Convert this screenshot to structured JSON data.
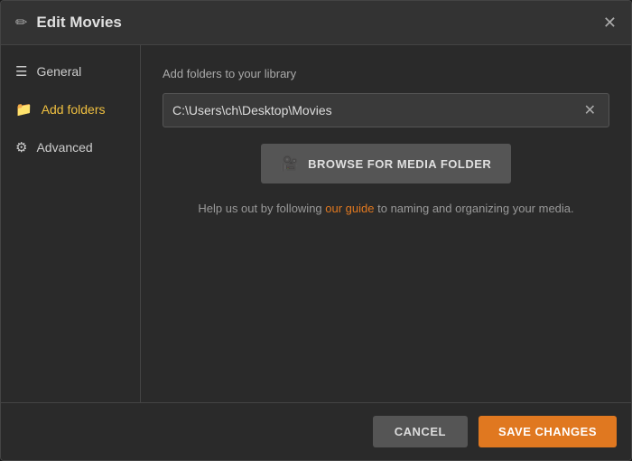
{
  "dialog": {
    "title": "Edit Movies",
    "close_icon": "✕"
  },
  "sidebar": {
    "items": [
      {
        "id": "general",
        "label": "General",
        "icon": "☰",
        "active": false
      },
      {
        "id": "add-folders",
        "label": "Add folders",
        "icon": "📁",
        "active": true
      },
      {
        "id": "advanced",
        "label": "Advanced",
        "icon": "⚙",
        "active": false
      }
    ]
  },
  "main": {
    "section_title": "Add folders to your library",
    "folder_path": "C:\\Users\\ch\\Desktop\\Movies",
    "browse_button_label": "BROWSE FOR MEDIA FOLDER",
    "browse_icon": "🎥",
    "help_text_before": "Help us out by following ",
    "help_link_text": "our guide",
    "help_text_after": " to naming and organizing your media."
  },
  "footer": {
    "cancel_label": "CANCEL",
    "save_label": "SAVE CHANGES"
  }
}
